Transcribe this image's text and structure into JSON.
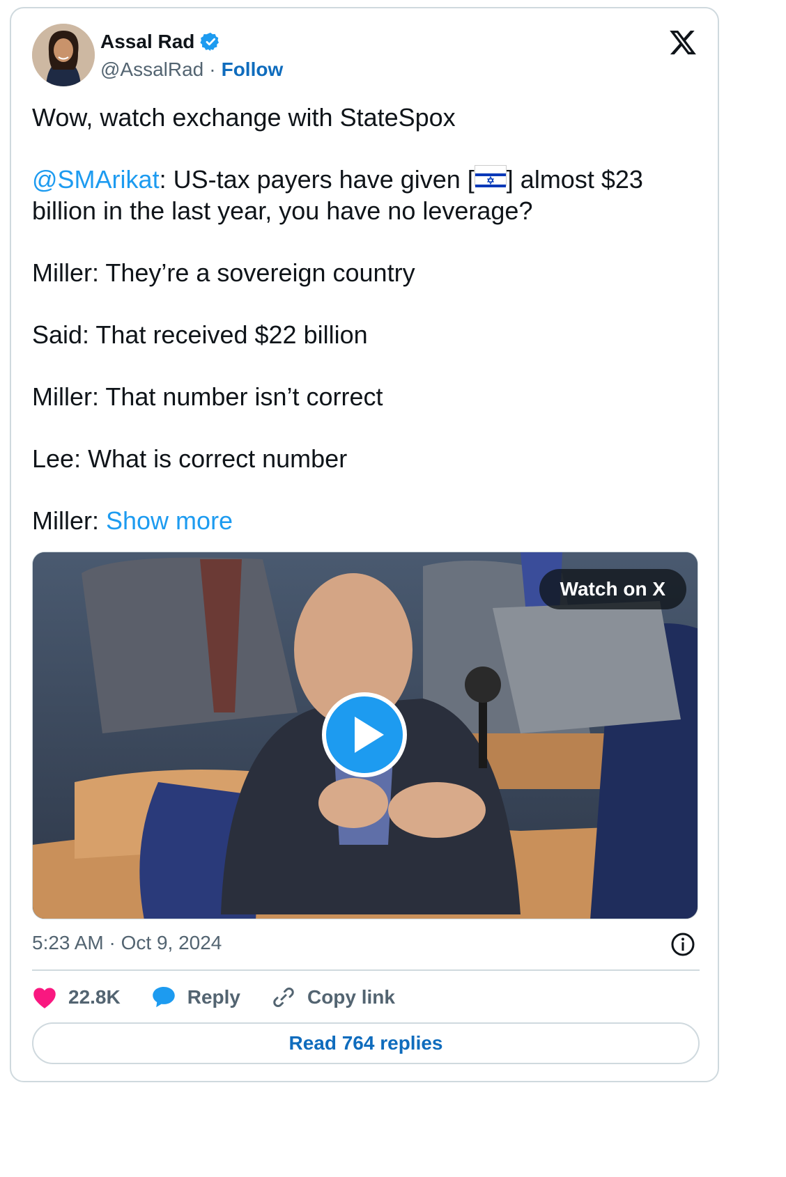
{
  "author": {
    "name": "Assal Rad",
    "handle": "@AssalRad",
    "separator": "·",
    "follow_label": "Follow"
  },
  "tweet": {
    "line1": "Wow, watch exchange with StateSpox",
    "mention": "@SMArikat",
    "line2_a": ": US-tax payers have given [",
    "line2_b": "] almost $23 billion in the last year, you have no leverage?",
    "line3": "Miller: They’re a sovereign country",
    "line4": "Said: That received $22 billion",
    "line5": "Miller: That number isn’t correct",
    "line6": "Lee: What is correct number",
    "line7_prefix": "Miller: ",
    "show_more": "Show more",
    "flag_icon": "israel-flag-icon"
  },
  "media": {
    "watch_label": "Watch on X"
  },
  "meta": {
    "timestamp": "5:23 AM · Oct 9, 2024"
  },
  "actions": {
    "likes": "22.8K",
    "reply": "Reply",
    "copy_link": "Copy link"
  },
  "read_replies": "Read 764 replies",
  "colors": {
    "link": "#1d9bf0",
    "follow": "#0f6cbd",
    "heart": "#f91880",
    "text": "#0f1419",
    "muted": "#536471"
  }
}
